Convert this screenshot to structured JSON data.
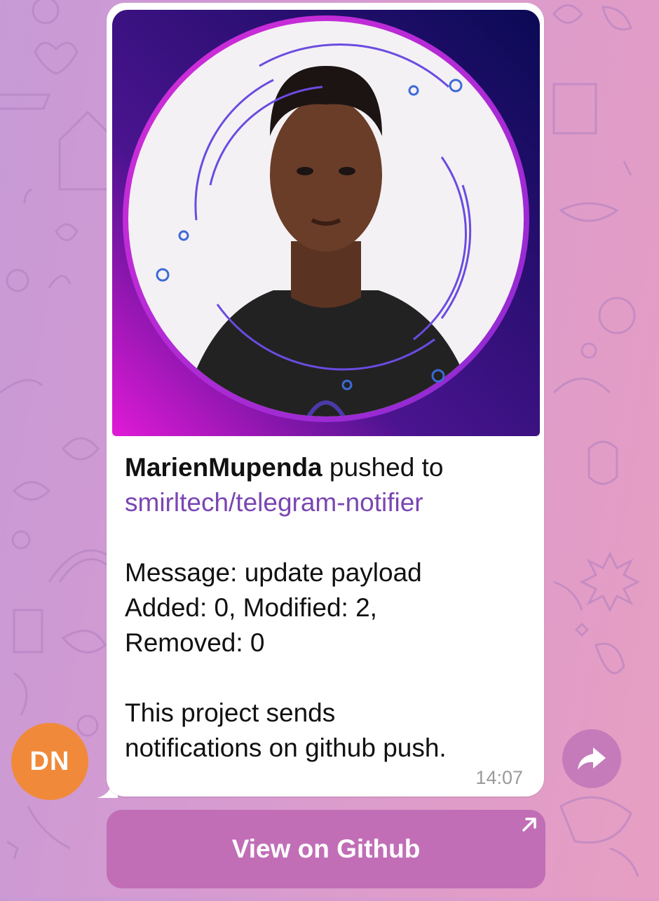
{
  "chat": {
    "wallpaper_colors": [
      "#c79ad6",
      "#e79ec2"
    ],
    "sender_avatar": {
      "initials": "DN",
      "color": "#f08a3a"
    }
  },
  "message": {
    "image_alt_icon": "profile-photo",
    "author": "MarienMupenda",
    "pushed_to_text": " pushed to",
    "repo": "smirltech/telegram-notifier",
    "commit_message_line": "Message: update payload",
    "stats_line_1": "Added: 0, Modified: 2,",
    "stats_line_2": "Removed: 0",
    "description_line_1": "This project sends",
    "description_line_2": "notifications on github push.",
    "time": "14:07",
    "accent_color": "#7a46b2"
  },
  "actions": {
    "forward_icon": "forward-arrow",
    "inline_button_label": "View on Github",
    "inline_button_icon": "external-link-arrow",
    "inline_button_color": "#c16eb6"
  }
}
